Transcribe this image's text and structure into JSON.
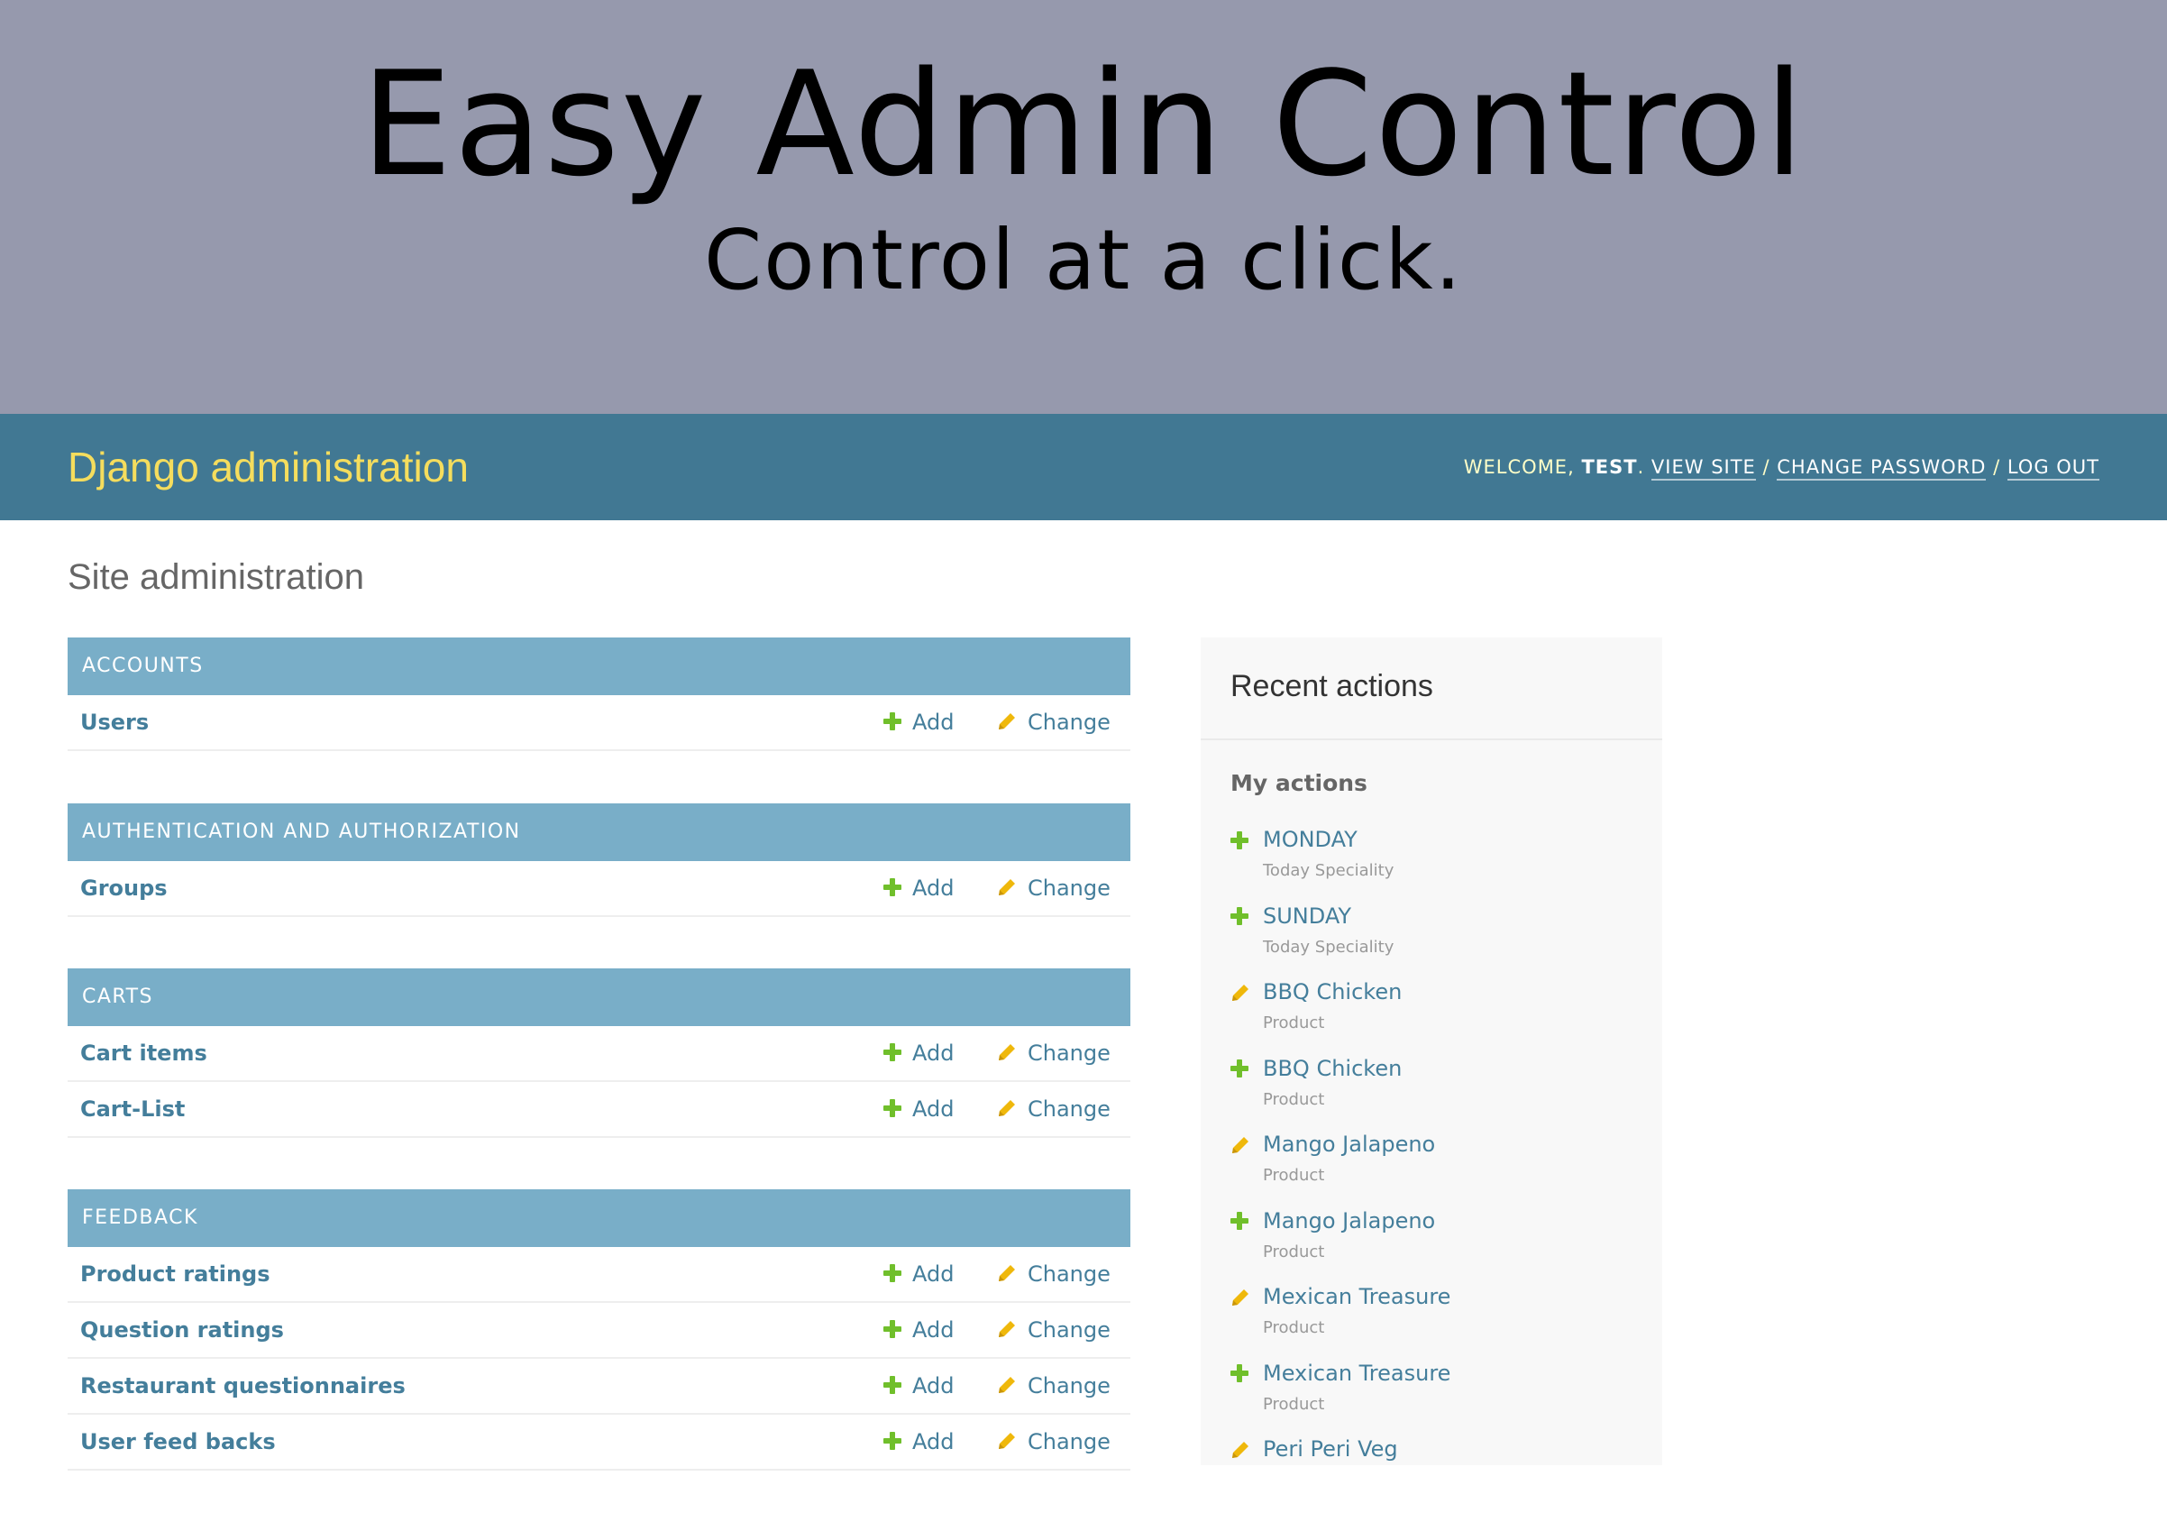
{
  "banner": {
    "title": "Easy Admin Control",
    "subtitle": "Control at a click."
  },
  "header": {
    "branding": "Django administration",
    "welcome": "WELCOME, ",
    "username": "TEST",
    "sep1": ". ",
    "view_site": "VIEW SITE",
    "slash1": " / ",
    "change_password": "CHANGE PASSWORD",
    "slash2": " / ",
    "log_out": "LOG OUT"
  },
  "page_title": "Site administration",
  "row_actions": {
    "add": "Add",
    "change": "Change"
  },
  "modules": [
    {
      "caption": "ACCOUNTS",
      "rows": [
        "Users"
      ]
    },
    {
      "caption": "AUTHENTICATION AND AUTHORIZATION",
      "rows": [
        "Groups"
      ]
    },
    {
      "caption": "CARTS",
      "rows": [
        "Cart items",
        "Cart-List"
      ]
    },
    {
      "caption": "FEEDBACK",
      "rows": [
        "Product ratings",
        "Question ratings",
        "Restaurant questionnaires",
        "User feed backs"
      ]
    }
  ],
  "recent": {
    "title": "Recent actions",
    "my_actions": "My actions",
    "items": [
      {
        "icon": "plus-icon",
        "name": "MONDAY",
        "type": "Today Speciality"
      },
      {
        "icon": "plus-icon",
        "name": "SUNDAY",
        "type": "Today Speciality"
      },
      {
        "icon": "pencil-icon",
        "name": "BBQ Chicken",
        "type": "Product"
      },
      {
        "icon": "plus-icon",
        "name": "BBQ Chicken",
        "type": "Product"
      },
      {
        "icon": "pencil-icon",
        "name": "Mango Jalapeno",
        "type": "Product"
      },
      {
        "icon": "plus-icon",
        "name": "Mango Jalapeno",
        "type": "Product"
      },
      {
        "icon": "pencil-icon",
        "name": "Mexican Treasure",
        "type": "Product"
      },
      {
        "icon": "plus-icon",
        "name": "Mexican Treasure",
        "type": "Product"
      },
      {
        "icon": "pencil-icon",
        "name": "Peri Peri Veg",
        "type": ""
      }
    ]
  },
  "colors": {
    "banner_bg": "#9699ad",
    "header_bg": "#417893",
    "branding": "#f5dd5d",
    "caption_bg": "#79aec8",
    "link": "#447e9b",
    "add_icon": "#70bf2b",
    "change_icon": "#efb80b"
  }
}
